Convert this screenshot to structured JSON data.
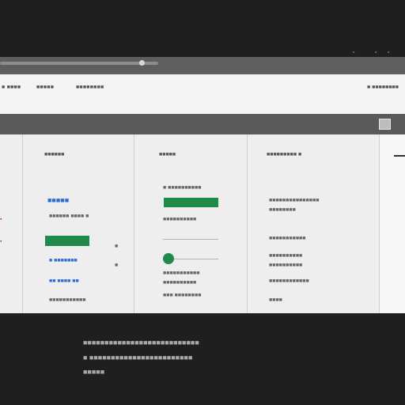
{
  "nav": {
    "tabs": [
      "■ ■■■■",
      "■■■■■",
      "■■■■■■■■"
    ],
    "right_label": "■ ■■■■■■■■"
  },
  "columns": [
    {
      "header": "",
      "items": []
    },
    {
      "header": "■■■■■■",
      "link1": "■■■■■",
      "text1": "■■■■■■ ■■■■ ■",
      "link2": "■ ■■■■■■■",
      "link3": "■■ ■■■■ ■■",
      "text2": "■■■■■■■■■■■",
      "scroll_marks": [
        "■",
        "■"
      ]
    },
    {
      "header": "■■■■■",
      "line1": "■ ■■■■■■■■■■",
      "line2": "■■■■■■■■■■",
      "line3": "■■■■■■■■■■■",
      "line4": "■■■■■■■■■■",
      "line5": "■■■■■■■■■■■",
      "line6": "■■■ ■■■■■■■■"
    },
    {
      "header": "■■■■■■■■■ ■",
      "a1": "■■■■■■■■■■■■■■■",
      "a2": "■■■■■■■■",
      "b1": "■■■■■■■■■■■",
      "c1": "■■■■■■■■■■",
      "c2": "■■■■■■■■■■",
      "d1": "■■■■■■■■■■■■",
      "d2": "■■■■"
    }
  ],
  "caption": {
    "line1": "■■■■■■■■■■■■■■■■■■■■■■■■■■■",
    "line2": "■ ■■■■■■■■■■■■■■■■■■■■■■■■",
    "line3": "■■■■■"
  },
  "colors": {
    "accent_green": "#1f8a4c",
    "link_blue": "#2d6bd6"
  }
}
